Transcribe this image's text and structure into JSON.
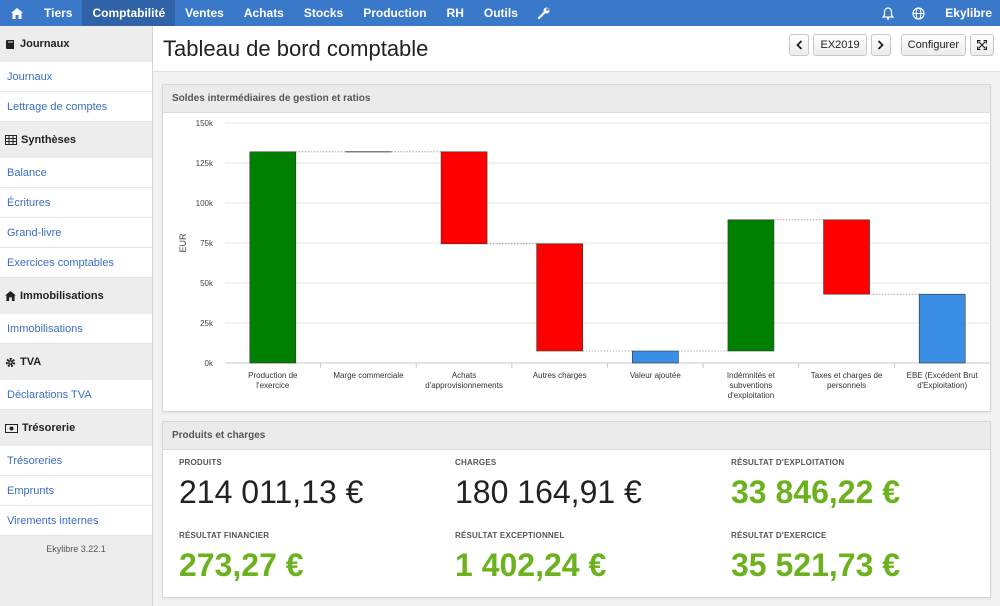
{
  "nav": {
    "items": [
      {
        "label": "Tiers"
      },
      {
        "label": "Comptabilité",
        "active": true
      },
      {
        "label": "Ventes"
      },
      {
        "label": "Achats"
      },
      {
        "label": "Stocks"
      },
      {
        "label": "Production"
      },
      {
        "label": "RH"
      },
      {
        "label": "Outils"
      }
    ],
    "user": "Ekylibre"
  },
  "sidebar": {
    "groups": [
      {
        "title": "Journaux",
        "icon": "book-icon",
        "links": [
          "Journaux",
          "Lettrage de comptes"
        ]
      },
      {
        "title": "Synthèses",
        "icon": "table-icon",
        "links": [
          "Balance",
          "Écritures",
          "Grand-livre",
          "Exercices comptables"
        ]
      },
      {
        "title": "Immobilisations",
        "icon": "home-icon",
        "links": [
          "Immobilisations"
        ]
      },
      {
        "title": "TVA",
        "icon": "gear-icon",
        "links": [
          "Déclarations TVA"
        ]
      },
      {
        "title": "Trésorerie",
        "icon": "money-icon",
        "links": [
          "Trésoreries",
          "Emprunts",
          "Virements internes"
        ]
      }
    ],
    "version": "Ekylibre 3.22.1"
  },
  "header": {
    "title": "Tableau de bord comptable",
    "year": "EX2019",
    "configure": "Configurer"
  },
  "chart_panel": {
    "title": "Soldes intermédiaires de gestion et ratios"
  },
  "chart_data": {
    "type": "bar",
    "subtype": "waterfall",
    "ylabel": "EUR",
    "ylim": [
      0,
      150000
    ],
    "yticks": [
      "0k",
      "25k",
      "50k",
      "75k",
      "100k",
      "125k",
      "150k"
    ],
    "categories": [
      [
        "Production de",
        "l'exercice"
      ],
      [
        "Marge commerciale"
      ],
      [
        "Achats",
        "d'approvisionnements"
      ],
      [
        "Autres charges"
      ],
      [
        "Valeur ajoutée"
      ],
      [
        "Indémnités et",
        "subventions",
        "d'exploitation"
      ],
      [
        "Taxes et charges de",
        "personnels"
      ],
      [
        "EBE (Excédent Brut",
        "d'Exploitation)"
      ]
    ],
    "bars": [
      {
        "low": 0,
        "high": 132000,
        "color": "#008000"
      },
      {
        "low": 132000,
        "high": 132000,
        "color": "#555555"
      },
      {
        "low": 74500,
        "high": 132000,
        "color": "#ff0000"
      },
      {
        "low": 7500,
        "high": 74500,
        "color": "#ff0000"
      },
      {
        "low": 0,
        "high": 7500,
        "color": "#3a8ee6"
      },
      {
        "low": 7500,
        "high": 89500,
        "color": "#008000"
      },
      {
        "low": 43000,
        "high": 89500,
        "color": "#ff0000"
      },
      {
        "low": 0,
        "high": 43000,
        "color": "#3a8ee6"
      }
    ]
  },
  "stats_panel": {
    "title": "Produits et charges"
  },
  "stats": [
    {
      "label": "PRODUITS",
      "value": "214 011,13 €",
      "green": false
    },
    {
      "label": "CHARGES",
      "value": "180 164,91 €",
      "green": false
    },
    {
      "label": "RÉSULTAT D'EXPLOITATION",
      "value": "33 846,22 €",
      "green": true
    },
    {
      "label": "RÉSULTAT FINANCIER",
      "value": "273,27 €",
      "green": true
    },
    {
      "label": "RÉSULTAT EXCEPTIONNEL",
      "value": "1 402,24 €",
      "green": true
    },
    {
      "label": "RÉSULTAT D'EXERCICE",
      "value": "35 521,73 €",
      "green": true
    }
  ]
}
